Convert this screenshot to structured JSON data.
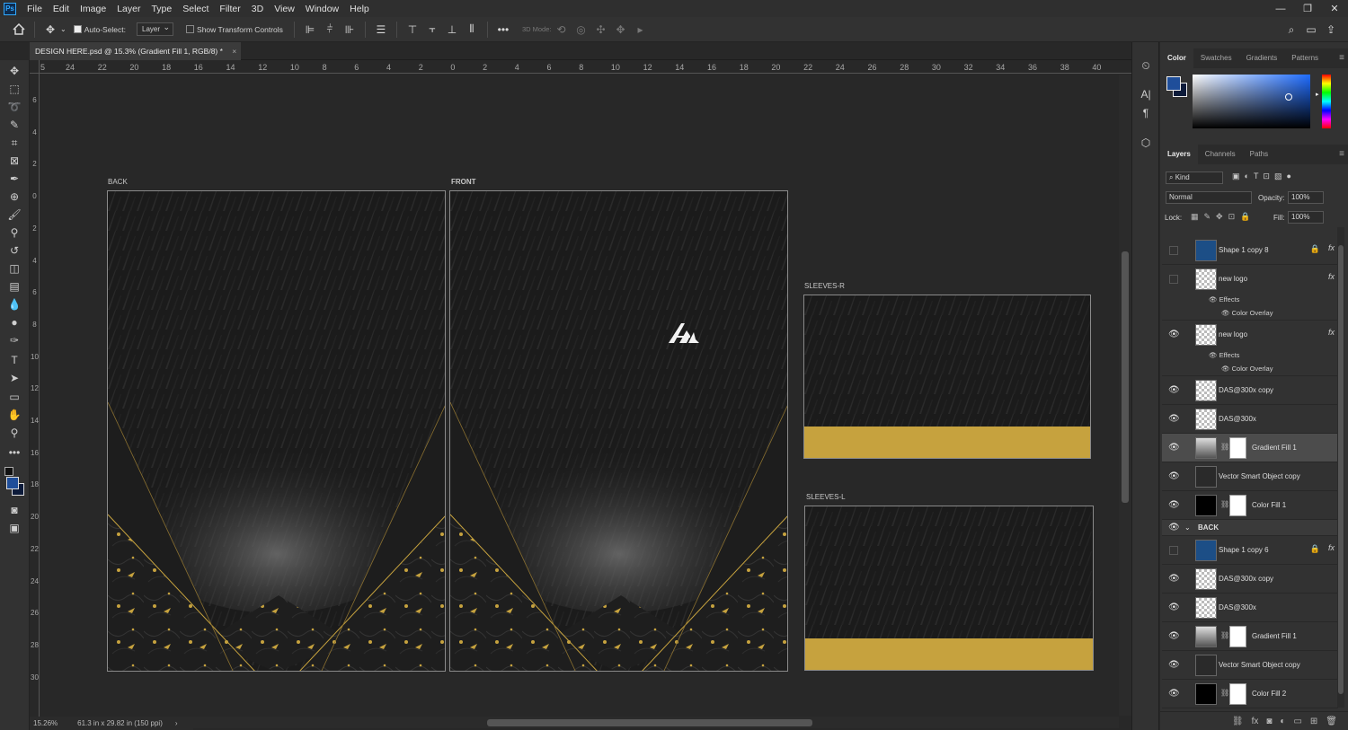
{
  "menu": {
    "logo": "Ps",
    "items": [
      "File",
      "Edit",
      "Image",
      "Layer",
      "Type",
      "Select",
      "Filter",
      "3D",
      "View",
      "Window",
      "Help"
    ],
    "window_controls": [
      "—",
      "❐",
      "✕"
    ]
  },
  "options_bar": {
    "auto_select_label": "Auto-Select:",
    "auto_select_value": "Layer",
    "show_transform_label": "Show Transform Controls",
    "mode_3d_label": "3D Mode:",
    "more_label": "•••"
  },
  "document": {
    "tab_title": "DESIGN HERE.psd @ 15.3% (Gradient Fill 1, RGB/8) *",
    "tab_close": "×"
  },
  "rulers": {
    "h_ticks": [
      "24",
      "22",
      "20",
      "18",
      "16",
      "14",
      "12",
      "10",
      "8",
      "6",
      "4",
      "2",
      "0",
      "2",
      "4",
      "6",
      "8",
      "10",
      "12",
      "14",
      "16",
      "18",
      "20",
      "22",
      "24",
      "26",
      "28",
      "30",
      "32",
      "34",
      "36",
      "38",
      "40"
    ],
    "v_ticks": [
      "6",
      "4",
      "2",
      "0",
      "2",
      "4",
      "6",
      "8",
      "10",
      "12",
      "14",
      "16",
      "18",
      "20",
      "22",
      "24",
      "26",
      "28",
      "30"
    ],
    "h_corner": "5"
  },
  "artboards": {
    "back_label": "BACK",
    "front_label": "FRONT",
    "sleeves_r_label": "SLEEVES-R",
    "sleeves_l_label": "SLEEVES-L",
    "gold_color": "#c6a23e",
    "base_color": "#1c1c1c"
  },
  "status": {
    "zoom": "15.26%",
    "doc_info": "61.3 in x 29.82 in (150 ppi)"
  },
  "panels": {
    "color_tabs": [
      "Color",
      "Swatches",
      "Gradients",
      "Patterns"
    ],
    "foreground_color": "#1f4e9a",
    "background_color": "#0d1b3a",
    "layer_tabs": [
      "Layers",
      "Channels",
      "Paths"
    ],
    "filter_kind": "Kind",
    "blend_mode": "Normal",
    "opacity_label": "Opacity:",
    "opacity_value": "100%",
    "lock_label": "Lock:",
    "fill_label": "Fill:",
    "fill_value": "100%",
    "layers": [
      {
        "name": "Shape 1 copy 8",
        "visible": false,
        "fx": true,
        "locked": true,
        "thumb": "blue"
      },
      {
        "name": "new logo",
        "visible": false,
        "fx": true,
        "locked": false,
        "thumb": "checker"
      },
      {
        "name": "new logo",
        "visible": true,
        "fx": true,
        "locked": false,
        "thumb": "checker"
      },
      {
        "name": "DAS@300x copy",
        "visible": true,
        "fx": false,
        "locked": false,
        "thumb": "checker"
      },
      {
        "name": "DAS@300x",
        "visible": true,
        "fx": false,
        "locked": false,
        "thumb": "checker"
      },
      {
        "name": "Gradient Fill 1",
        "visible": true,
        "fx": false,
        "locked": false,
        "thumb": "gradient",
        "mask": true,
        "selected": true
      },
      {
        "name": "Vector Smart Object copy",
        "visible": true,
        "fx": false,
        "locked": false,
        "thumb": "dark"
      },
      {
        "name": "Color Fill 1",
        "visible": true,
        "fx": false,
        "locked": false,
        "thumb": "black",
        "mask": true
      }
    ],
    "effects_label": "Effects",
    "color_overlay_label": "Color Overlay",
    "group_back": "BACK",
    "back_layers": [
      {
        "name": "Shape 1 copy 6",
        "visible": false,
        "fx": true,
        "locked": true,
        "thumb": "blue"
      },
      {
        "name": "DAS@300x copy",
        "visible": true,
        "fx": false,
        "locked": false,
        "thumb": "checker"
      },
      {
        "name": "DAS@300x",
        "visible": true,
        "fx": false,
        "locked": false,
        "thumb": "checker"
      },
      {
        "name": "Gradient Fill 1",
        "visible": true,
        "fx": false,
        "locked": false,
        "thumb": "gradient",
        "mask": true
      },
      {
        "name": "Vector Smart Object copy",
        "visible": true,
        "fx": false,
        "locked": false,
        "thumb": "dark"
      },
      {
        "name": "Color Fill 2",
        "visible": true,
        "fx": false,
        "locked": false,
        "thumb": "black",
        "mask": true
      }
    ]
  }
}
